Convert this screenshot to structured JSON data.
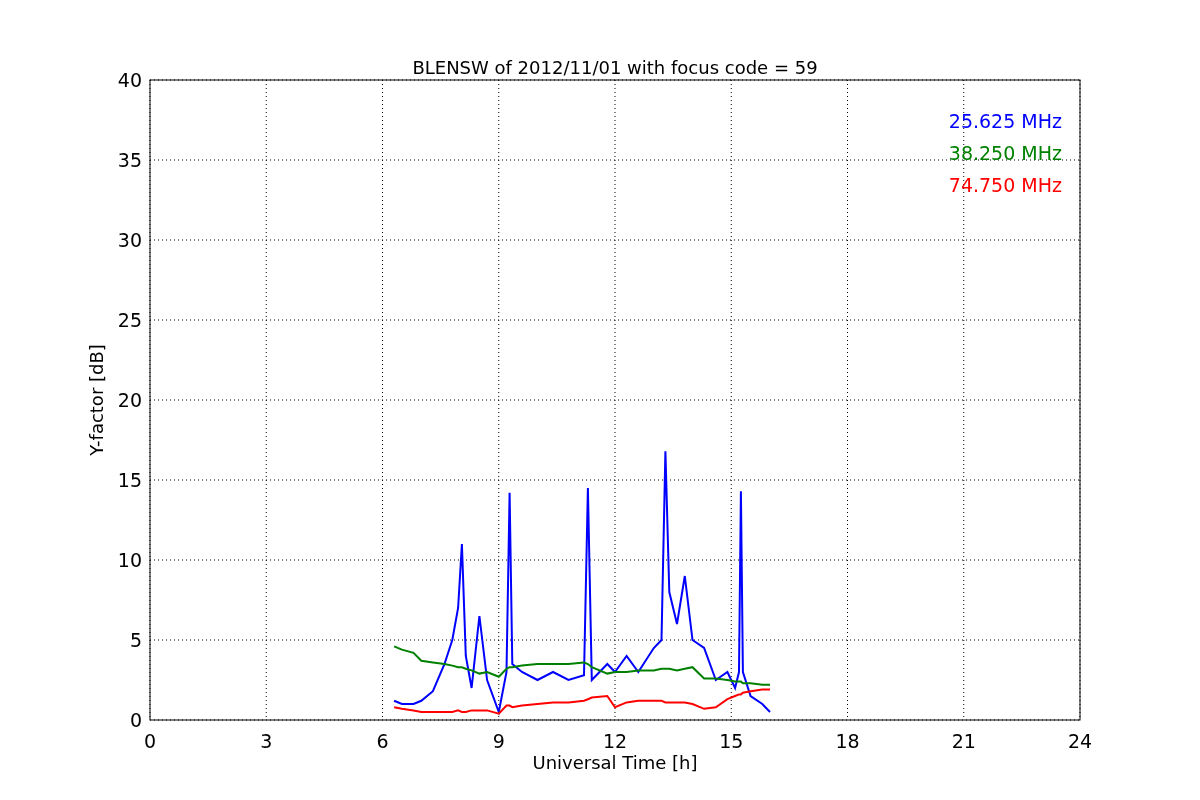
{
  "chart_data": {
    "type": "line",
    "title": "BLENSW of 2012/11/01 with focus code = 59",
    "xlabel": "Universal Time [h]",
    "ylabel": "Y-factor [dB]",
    "xlim": [
      0,
      24
    ],
    "ylim": [
      0,
      40
    ],
    "xticks": [
      0,
      3,
      6,
      9,
      12,
      15,
      18,
      21,
      24
    ],
    "yticks": [
      0,
      5,
      10,
      15,
      20,
      25,
      30,
      35,
      40
    ],
    "grid": true,
    "x": [
      6.3,
      6.5,
      6.8,
      7.0,
      7.3,
      7.6,
      7.8,
      7.95,
      8.05,
      8.15,
      8.3,
      8.5,
      8.7,
      9.0,
      9.2,
      9.28,
      9.35,
      9.6,
      10.0,
      10.4,
      10.8,
      11.2,
      11.3,
      11.4,
      11.8,
      12.0,
      12.3,
      12.6,
      13.0,
      13.2,
      13.3,
      13.4,
      13.6,
      13.8,
      14.0,
      14.3,
      14.6,
      14.9,
      15.1,
      15.2,
      15.25,
      15.3,
      15.5,
      15.8,
      16.0
    ],
    "series": [
      {
        "name": "25.625 MHz",
        "color": "#0000ff",
        "values": [
          1.2,
          1.0,
          1.0,
          1.2,
          1.8,
          3.5,
          5.0,
          7.0,
          11.0,
          4.0,
          2.0,
          6.5,
          2.5,
          0.5,
          3.0,
          14.2,
          3.5,
          3.0,
          2.5,
          3.0,
          2.5,
          2.8,
          14.5,
          2.5,
          3.5,
          3.0,
          4.0,
          3.0,
          4.5,
          5.0,
          16.8,
          8.0,
          6.0,
          9.0,
          5.0,
          4.5,
          2.5,
          3.0,
          2.0,
          3.0,
          14.3,
          3.0,
          1.5,
          1.0,
          0.5
        ]
      },
      {
        "name": "38.250 MHz",
        "color": "#008000",
        "values": [
          4.6,
          4.4,
          4.2,
          3.7,
          3.6,
          3.5,
          3.4,
          3.3,
          3.3,
          3.2,
          3.1,
          2.9,
          3.0,
          2.7,
          3.2,
          3.3,
          3.3,
          3.4,
          3.5,
          3.5,
          3.5,
          3.6,
          3.5,
          3.3,
          2.9,
          3.0,
          3.0,
          3.1,
          3.1,
          3.2,
          3.2,
          3.2,
          3.1,
          3.2,
          3.3,
          2.6,
          2.6,
          2.5,
          2.4,
          2.4,
          2.4,
          2.3,
          2.3,
          2.2,
          2.2
        ]
      },
      {
        "name": "74.750 MHz",
        "color": "#ff0000",
        "values": [
          0.8,
          0.7,
          0.6,
          0.5,
          0.5,
          0.5,
          0.5,
          0.6,
          0.5,
          0.5,
          0.6,
          0.6,
          0.6,
          0.4,
          0.9,
          0.9,
          0.8,
          0.9,
          1.0,
          1.1,
          1.1,
          1.2,
          1.3,
          1.4,
          1.5,
          0.8,
          1.1,
          1.2,
          1.2,
          1.2,
          1.1,
          1.1,
          1.1,
          1.1,
          1.0,
          0.7,
          0.8,
          1.3,
          1.5,
          1.6,
          1.6,
          1.7,
          1.8,
          1.9,
          1.9
        ]
      }
    ]
  }
}
